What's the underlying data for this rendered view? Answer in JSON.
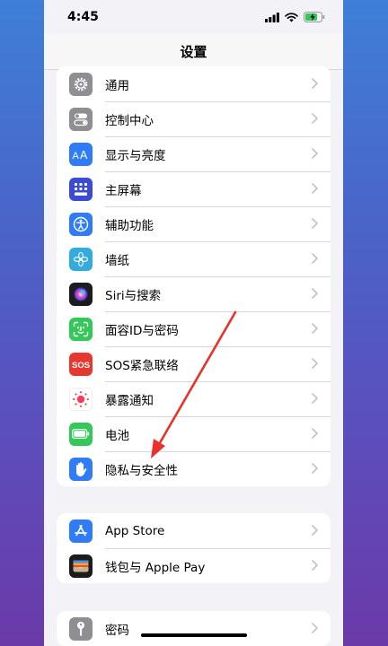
{
  "status": {
    "time": "4:45"
  },
  "nav": {
    "title": "设置"
  },
  "groups": [
    {
      "items": [
        {
          "label": "通用",
          "icon": "gear-icon",
          "color": "#8e8e93"
        },
        {
          "label": "控制中心",
          "icon": "toggles-icon",
          "color": "#8e8e93"
        },
        {
          "label": "显示与亮度",
          "icon": "text-size-icon",
          "color": "#2f7cf6"
        },
        {
          "label": "主屏幕",
          "icon": "home-grid-icon",
          "color": "#3c4bd6"
        },
        {
          "label": "辅助功能",
          "icon": "accessibility-icon",
          "color": "#2f7cf6"
        },
        {
          "label": "墙纸",
          "icon": "flower-icon",
          "color": "#35aadc"
        },
        {
          "label": "Siri与搜索",
          "icon": "siri-icon",
          "color": "#1c1c1e"
        },
        {
          "label": "面容ID与密码",
          "icon": "face-id-icon",
          "color": "#34c759"
        },
        {
          "label": "SOS紧急联络",
          "icon": "sos-icon",
          "color": "#e5392f"
        },
        {
          "label": "暴露通知",
          "icon": "exposure-icon",
          "color": "#ffffff"
        },
        {
          "label": "电池",
          "icon": "battery-icon",
          "color": "#34c759"
        },
        {
          "label": "隐私与安全性",
          "icon": "hand-icon",
          "color": "#2f7cf6"
        }
      ]
    },
    {
      "items": [
        {
          "label": "App Store",
          "icon": "app-store-icon",
          "color": "#2f7cf6"
        },
        {
          "label": "钱包与 Apple Pay",
          "icon": "wallet-icon",
          "color": "#1c1c1e"
        }
      ]
    },
    {
      "items": [
        {
          "label": "密码",
          "icon": "key-icon",
          "color": "#8e8e93"
        }
      ]
    }
  ]
}
